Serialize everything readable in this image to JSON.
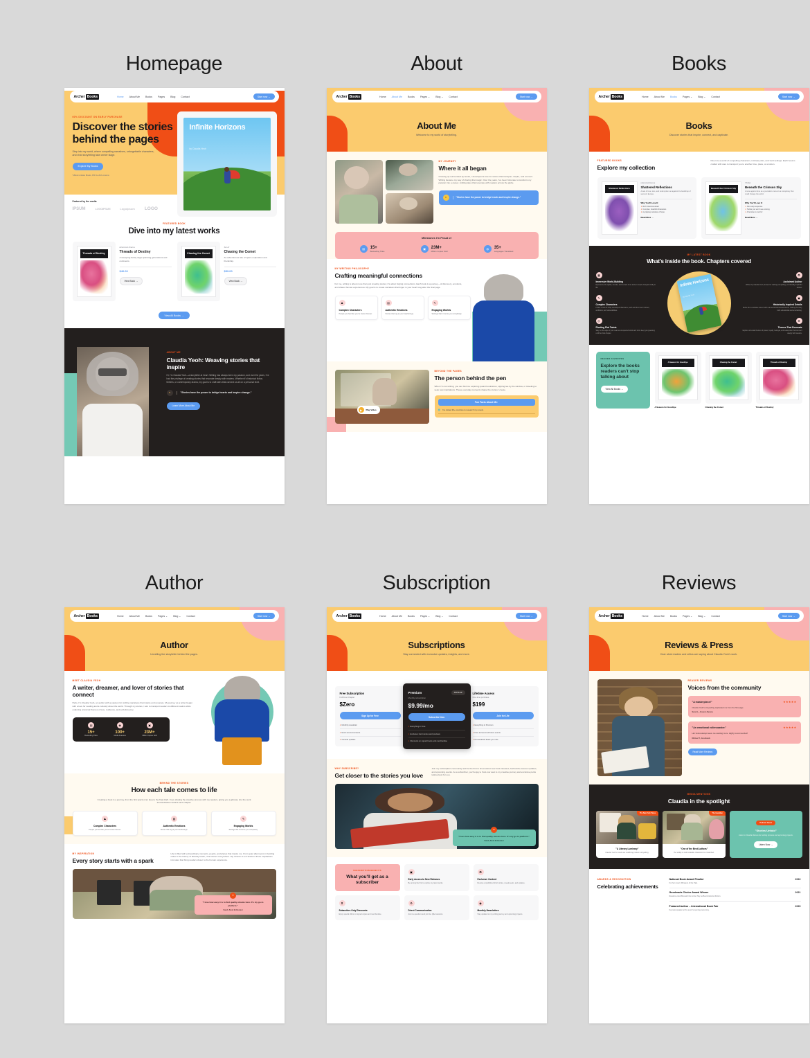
{
  "thumbnails": [
    {
      "title": "Homepage"
    },
    {
      "title": "About"
    },
    {
      "title": "Books"
    },
    {
      "title": "Author"
    },
    {
      "title": "Subscription"
    },
    {
      "title": "Reviews"
    }
  ],
  "brand": {
    "name": "Archer",
    "tag": "Books"
  },
  "nav": {
    "items": [
      "Home",
      "About Me",
      "Books",
      "Pages",
      "Blog",
      "Contact"
    ],
    "cta": "Start now",
    "cta_icon": "arrow-right-icon"
  },
  "homepage": {
    "hero": {
      "eyebrow": "60% DISCOUNT ON EARLY PURCHASE",
      "title": "Discover the stories behind the pages",
      "body": "Step into my world, where compelling narratives, unforgettable characters, and vivid storytelling take center stage.",
      "cta": "Explore My Books",
      "note": "*eBook includes iBooks, PDF & ePub versions"
    },
    "book_cover": {
      "title": "Infinite Horizons",
      "by": "by Claudia Yeoh"
    },
    "media": {
      "label": "Featured by the media",
      "logos": [
        "IPSUM",
        "LOGOIPSUM",
        "Logoipsum",
        "LOGO"
      ]
    },
    "featured": {
      "eyebrow": "FEATURED BOOK",
      "title": "Dive into my latest works",
      "view_all": "View All Books",
      "books": [
        {
          "genre": "Historical Drama",
          "title": "Threads of Destiny",
          "desc": "A sweeping family saga spanning generations and continents.",
          "price": "$40.00",
          "cta": "View Book",
          "art": "art-pink"
        },
        {
          "genre": "Sci-Fi",
          "title": "Chasing the Comet",
          "desc": "An adventurous tale of space exploration and friendship.",
          "price": "$59.00",
          "cta": "View Book",
          "art": "art-green"
        }
      ]
    },
    "about": {
      "eyebrow": "ABOUT ME",
      "title": "Claudia Yeoh: Weaving stories that inspire",
      "body": "Hi, I'm Claudia Yeoh—a storyteller at heart. Writing has always been my passion, and over the years, I've had the privilege of creating stories that resonate deeply with readers. Whether it's historical fiction, thrillers, or contemporary drama, my goal is to craft tales that connect us all on a personal level.",
      "quote": "\"Stories have the power to bridge hearts and inspire change.\"",
      "cta": "Learn More About Me"
    }
  },
  "about_page": {
    "hero": {
      "title": "About Me",
      "subtitle": "Welcome to my world of storytelling."
    },
    "journey": {
      "eyebrow": "MY JOURNEY",
      "title": "Where it all began",
      "body": "Growing up surrounded by books, I developed a love for stories that transport, inspire, and connect. Writing became my way of sharing that magic. Over the years, I've been fortunate to transform my passion into a career, crafting tales that resonate with readers across the globe.",
      "quote": "\"Stories have the power to bridge hearts and inspire change.\""
    },
    "milestones": {
      "title": "Milestones I'm Proud of",
      "items": [
        {
          "value": "15+",
          "label": "Bestselling Titles",
          "icon": "book-list-icon"
        },
        {
          "value": "23M+",
          "label": "Million Copies Sold",
          "icon": "book-icon"
        },
        {
          "value": "35+",
          "label": "Languages Translated",
          "icon": "globe-icon"
        }
      ]
    },
    "crafting": {
      "eyebrow": "MY WRITING PHILOSOPHY",
      "title": "Crafting meaningful connections",
      "body": "For me, writing is about more than just creating stories; it's about forging connections. Each book is a journey—of discovery, emotions, and shared human experiences. My goal is to create narratives that linger in your heart long after the final page.",
      "cards": [
        {
          "title": "Complex Characters",
          "desc": "People you feel like you've known forever.",
          "icon": "characters-icon"
        },
        {
          "title": "Authentic Emotions",
          "desc": "Stories that tug at your heartstrings.",
          "icon": "heart-book-icon"
        },
        {
          "title": "Engaging Worlds",
          "desc": "Settings that immerse you completely.",
          "icon": "pen-icon"
        }
      ]
    },
    "behind": {
      "eyebrow": "BEYOND THE PAGES",
      "title": "The person behind the pen",
      "body": "When I'm not writing, you can find me exploring quaint bookstores, sipping tea by the window, or traveling to seek new inspirations. These everyday moments shape the stories I create.",
      "play": "Play Video",
      "facts_title": "Fun Facts About Me:",
      "fact": "I've visited 30+ countries to research my novels."
    }
  },
  "books_page": {
    "hero": {
      "title": "Books",
      "subtitle": "Discover stories that inspire, connect, and captivate."
    },
    "collection": {
      "eyebrow": "FEATURED BOOKS",
      "title": "Explore my collection",
      "intro": "Dive into a world of compelling characters, intricate plots, and vivid settings. Each book is crafted with care to transport you to another time, place, or emotion.",
      "books": [
        {
          "genre": "Historical Drama",
          "title": "Shattered Reflections",
          "desc": "A tale of love, loss, and redemption set against the backdrop of war-torn Europe.",
          "why": "Why You'll Love It:",
          "bullets": [
            "Rich historical detail",
            "Complex, heartfelt characters",
            "A gripping narrative of hope"
          ],
          "cta": "Read More",
          "art": "art-purple"
        },
        {
          "genre": "Thriller",
          "title": "Beneath the Crimson Sky",
          "desc": "A race against time as a journalist uncovers a conspiracy that could change the world.",
          "why": "Why You'll Love It:",
          "bullets": [
            "Non-stop suspense",
            "Twists you won't see coming",
            "A heroine to root for"
          ],
          "cta": "Read More",
          "art": "art-blue"
        }
      ]
    },
    "inside": {
      "eyebrow": "MY LATEST BOOK",
      "title": "What's inside the book. Chapters covered",
      "cover": {
        "title": "Infinite Horizons",
        "by": "by Claudia Yeoh"
      },
      "left": [
        {
          "title": "Immersive World-Building",
          "desc": "Experience the sights, sounds, and secrets of an ancient empire brought vividly to life.",
          "icon": "world-icon"
        },
        {
          "title": "Complex Characters",
          "desc": "Follow a cast of richly developed characters, each with their own motives, ambitions, and vulnerabilities.",
          "icon": "pen-icon"
        },
        {
          "title": "Riveting Plot Twists",
          "desc": "Stay on the edge of your seat as unexpected twists and turns keep you guessing until the final chapter.",
          "icon": "twist-icon"
        }
      ],
      "right": [
        {
          "title": "Acclaimed Author",
          "desc": "Written by Claudia Yeoh, known for crafting compelling, emotionally impactful stories.",
          "icon": "award-icon"
        },
        {
          "title": "Historically Inspired Details",
          "desc": "Delve into a narrative woven with real-world historical elements, making the story both educational and entertaining.",
          "icon": "book-icon"
        },
        {
          "title": "Themes That Resonate",
          "desc": "Explore universal themes of power, loyalty, betrayal, and redemption that connect deeply with readers.",
          "icon": "gear-icon"
        }
      ]
    },
    "favorites": {
      "eyebrow": "READER FAVORITES",
      "title": "Explore the books readers can't stop talking about",
      "cta": "View All Books",
      "books": [
        {
          "title": "A Season for Goodbye",
          "art": "art-orange"
        },
        {
          "title": "Chasing the Comet",
          "art": "art-green"
        },
        {
          "title": "Threads of Destiny",
          "art": "art-pink"
        }
      ]
    }
  },
  "author_page": {
    "hero": {
      "title": "Author",
      "subtitle": "Unveiling the storyteller behind the pages."
    },
    "meet": {
      "eyebrow": "MEET CLAUDIA YEOH",
      "title": "A writer, dreamer, and lover of stories that connect",
      "body": "Hello, I'm Claudia Yeoh, an author with a passion for crafting narratives that inspire and resonate. My journey as a writer began with a love for reading and a curiosity about the world. Through my stories, I aim to transport readers to different realms while exploring universal themes of love, resilience, and self-discovery.",
      "stats": [
        {
          "value": "15+",
          "label": "Bestselling Titles",
          "icon": "book-list-icon"
        },
        {
          "value": "100+",
          "label": "Media Features",
          "icon": "media-icon"
        },
        {
          "value": "23M+",
          "label": "Million Copies Sold",
          "icon": "book-icon"
        }
      ]
    },
    "process": {
      "eyebrow": "BEHIND THE STORIES",
      "title": "How each tale comes to life",
      "body": "Creating a book is a journey, from the first spark of an idea to the final draft. I love sharing the creative process with my readers, giving you a glimpse into the work and dedication behind each chapter.",
      "cards": [
        {
          "title": "Complex Characters",
          "desc": "People you feel like you've known forever.",
          "icon": "characters-icon"
        },
        {
          "title": "Authentic Emotions",
          "desc": "Stories that tug at your heartstrings.",
          "icon": "heart-book-icon"
        },
        {
          "title": "Engaging Worlds",
          "desc": "Settings that immerse you completely.",
          "icon": "pen-icon"
        }
      ]
    },
    "inspiration": {
      "eyebrow": "MY INSPIRATION",
      "title": "Every story starts with a spark",
      "body": "Life is filled with extraordinary moments, people, and places that inspire me. From quiet afternoons in bustling cafes to the history of faraway lands, I find stories everywhere. My mission is to transform these inspirations into tales that bring readers closer to the human experience.",
      "quote": "\"I love how easy it is to find quality ebooks here. It's my go-to platform.\"",
      "quote_author": "Sarah, Book Enthusiast"
    }
  },
  "subscription_page": {
    "hero": {
      "title": "Subscriptions",
      "subtitle": "Stay connected with exclusive updates, insights, and more."
    },
    "plans": [
      {
        "name": "Free Subscription",
        "sub": "Full Free Chapter",
        "price": "$Zero",
        "cta": "Sign Up for Free",
        "badge": "",
        "features": [
          "Monthly newsletter",
          "Event announcements",
          "General updates"
        ]
      },
      {
        "name": "Premium",
        "sub": "Monthly subscription",
        "price": "$9.99/mo",
        "cta": "Subscribe Now",
        "badge": "POPULAR",
        "features": [
          "Everything in Free",
          "Exclusive short stories and previews",
          "Discounts on signed books and merchandise"
        ]
      },
      {
        "name": "Lifetime Access",
        "sub": "One-time purchase",
        "price": "$199",
        "cta": "Join for Life",
        "badge": "",
        "features": [
          "Everything in Premium",
          "Free access to all future events",
          "Personalized thank-you note"
        ]
      }
    ],
    "closer": {
      "eyebrow": "WHY SUBSCRIBE?",
      "title": "Get closer to the stories you love",
      "body": "Join my subscription community and be the first to know about new book releases, behind-the-scenes updates, and upcoming events. As a subscriber, you'll enjoy a front-row seat to my creative journey and exclusive perks tailored just for you.",
      "quote": "\"I love how easy it is to find quality ebooks here. It's my go-to platform.\"",
      "quote_author": "Sarah, Book Enthusiast"
    },
    "benefits": {
      "eyebrow": "SUBSCRIPTION BENEFITS",
      "title": "What you'll get as a subscriber",
      "items": [
        {
          "title": "Early Access to New Releases",
          "desc": "Be among the first to explore my latest works.",
          "icon": "book-icon"
        },
        {
          "title": "Exclusive Content",
          "desc": "Receive unpublished short stories, sneak peeks, and updates.",
          "icon": "award-icon"
        },
        {
          "title": "Subscriber-Only Discounts",
          "desc": "Enjoy special offers on signed copies and merchandise.",
          "icon": "hourglass-icon"
        },
        {
          "title": "Direct Communication",
          "desc": "Ask me questions and join live Q&A sessions.",
          "icon": "gear-icon"
        },
        {
          "title": "Monthly Newsletters",
          "desc": "Stay updated on my writing journey and upcoming projects.",
          "icon": "broadcast-icon"
        }
      ]
    }
  },
  "reviews_page": {
    "hero": {
      "title": "Reviews & Press",
      "subtitle": "Hear what readers and critics are saying about Claudia Yeoh's work."
    },
    "voices": {
      "eyebrow": "READER REVIEWS",
      "title": "Voices from the community",
      "cta": "Read More Reviews",
      "items": [
        {
          "quote": "\"A masterpiece!\"",
          "stars": "★★★★★",
          "body": "Claudia Yeoh's storytelling captivated me from the first page.",
          "author": "Sarah L., Amazon Review"
        },
        {
          "quote": "\"An emotional rollercoaster.\"",
          "stars": "★★★★★",
          "body": "Her books always leave me wanting more. Highly recommended!",
          "author": "Michael T., Goodreads"
        }
      ]
    },
    "spotlight": {
      "eyebrow": "MEDIA MENTIONS",
      "title": "Claudia in the spotlight",
      "cards": [
        {
          "source": "The New York Times",
          "quote": "\"A Literary Luminary\"",
          "desc": "Claudia Yeoh's novels are redefining modern storytelling."
        },
        {
          "source": "The Guardian",
          "quote": "\"One of the Best Authors\"",
          "desc": "Her ability to craft relatable characters is unmatched."
        }
      ],
      "podcast": {
        "badge": "Podcast Guest",
        "title": "\"Stories Unfold\"",
        "desc": "Listen to Claudia discuss her writing process and upcoming projects.",
        "cta": "Listen Now"
      }
    },
    "awards": {
      "eyebrow": "AWARDS & RECOGNITION",
      "title": "Celebrating achievements",
      "items": [
        {
          "title": "National Book Award Finalist",
          "desc": "For her novel, Whispers of the Past.",
          "year": "2022"
        },
        {
          "title": "Goodreads Choice Award Winner",
          "desc": "Readers voted Beneath the Amber Sky as Best Historical Fiction.",
          "year": "2021"
        },
        {
          "title": "Featured Author – International Book Fair",
          "desc": "Keynote speaker at the event's opening ceremony.",
          "year": "2020"
        }
      ]
    }
  }
}
